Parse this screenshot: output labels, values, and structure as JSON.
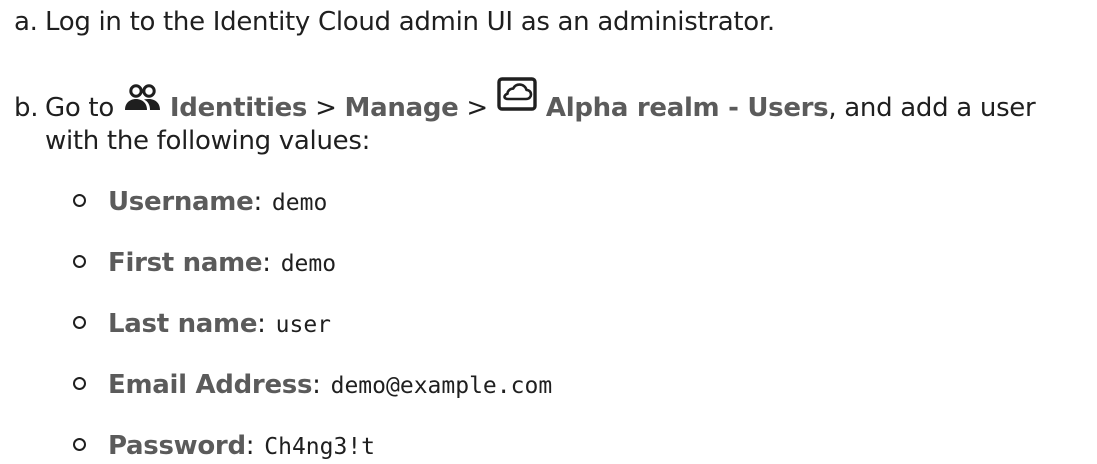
{
  "steps": {
    "a": {
      "marker": "a.",
      "text": "Log in to the Identity Cloud admin UI as an administrator."
    },
    "b": {
      "marker": "b.",
      "prefix": "Go to ",
      "nav_identities": "Identities",
      "sep1": " > ",
      "nav_manage": "Manage",
      "sep2": " > ",
      "nav_realm": "Alpha realm - Users",
      "suffix": ", and add a user",
      "continuation": "with the following values:",
      "icons": {
        "identities": "people-icon",
        "realm": "cloud-realm-icon"
      }
    }
  },
  "fields": [
    {
      "label": "Username",
      "colon": ":",
      "value": "demo"
    },
    {
      "label": "First name",
      "colon": ":",
      "value": "demo"
    },
    {
      "label": "Last name",
      "colon": ":",
      "value": "user"
    },
    {
      "label": "Email Address",
      "colon": ":",
      "value": "demo@example.com"
    },
    {
      "label": "Password",
      "colon": ":",
      "value": "Ch4ng3!t"
    }
  ],
  "colors": {
    "text": "#1f1f1f",
    "ui_label": "#5b5b5b",
    "background": "#ffffff"
  }
}
